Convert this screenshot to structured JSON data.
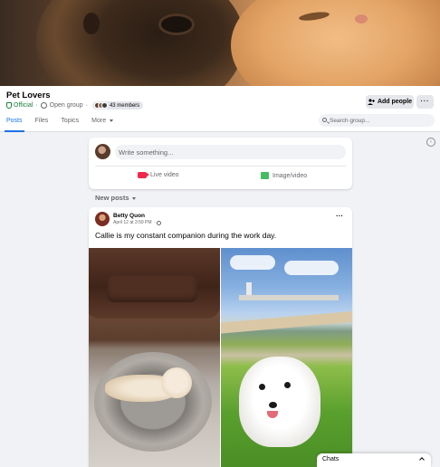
{
  "group": {
    "name": "Pet Lovers",
    "official_label": "Official",
    "separator": "·",
    "privacy": "Open group",
    "members": "43 members"
  },
  "header_actions": {
    "add_people": "Add people",
    "more": "···"
  },
  "tabs": [
    {
      "label": "Posts",
      "active": true
    },
    {
      "label": "Files",
      "active": false
    },
    {
      "label": "Topics",
      "active": false
    },
    {
      "label": "More",
      "active": false
    }
  ],
  "search": {
    "placeholder": "Search group..."
  },
  "composer": {
    "placeholder": "Write something...",
    "live_video": "Live video",
    "image_video": "Image/video"
  },
  "feed": {
    "sort_label": "New posts"
  },
  "post": {
    "author": "Betty Quon",
    "timestamp": "April 12 at 3:59 PM",
    "text": "Callie is my constant companion during the work day.",
    "more": "···"
  },
  "chats": {
    "label": "Chats"
  },
  "colors": {
    "accent": "#1b74e4",
    "official": "#1b7d3c",
    "live": "#f02849",
    "photo": "#45bd62"
  },
  "icons": [
    "shield-icon",
    "globe-icon",
    "search-icon",
    "live-video-icon",
    "image-icon",
    "collapse-icon",
    "chevron-up-icon"
  ]
}
